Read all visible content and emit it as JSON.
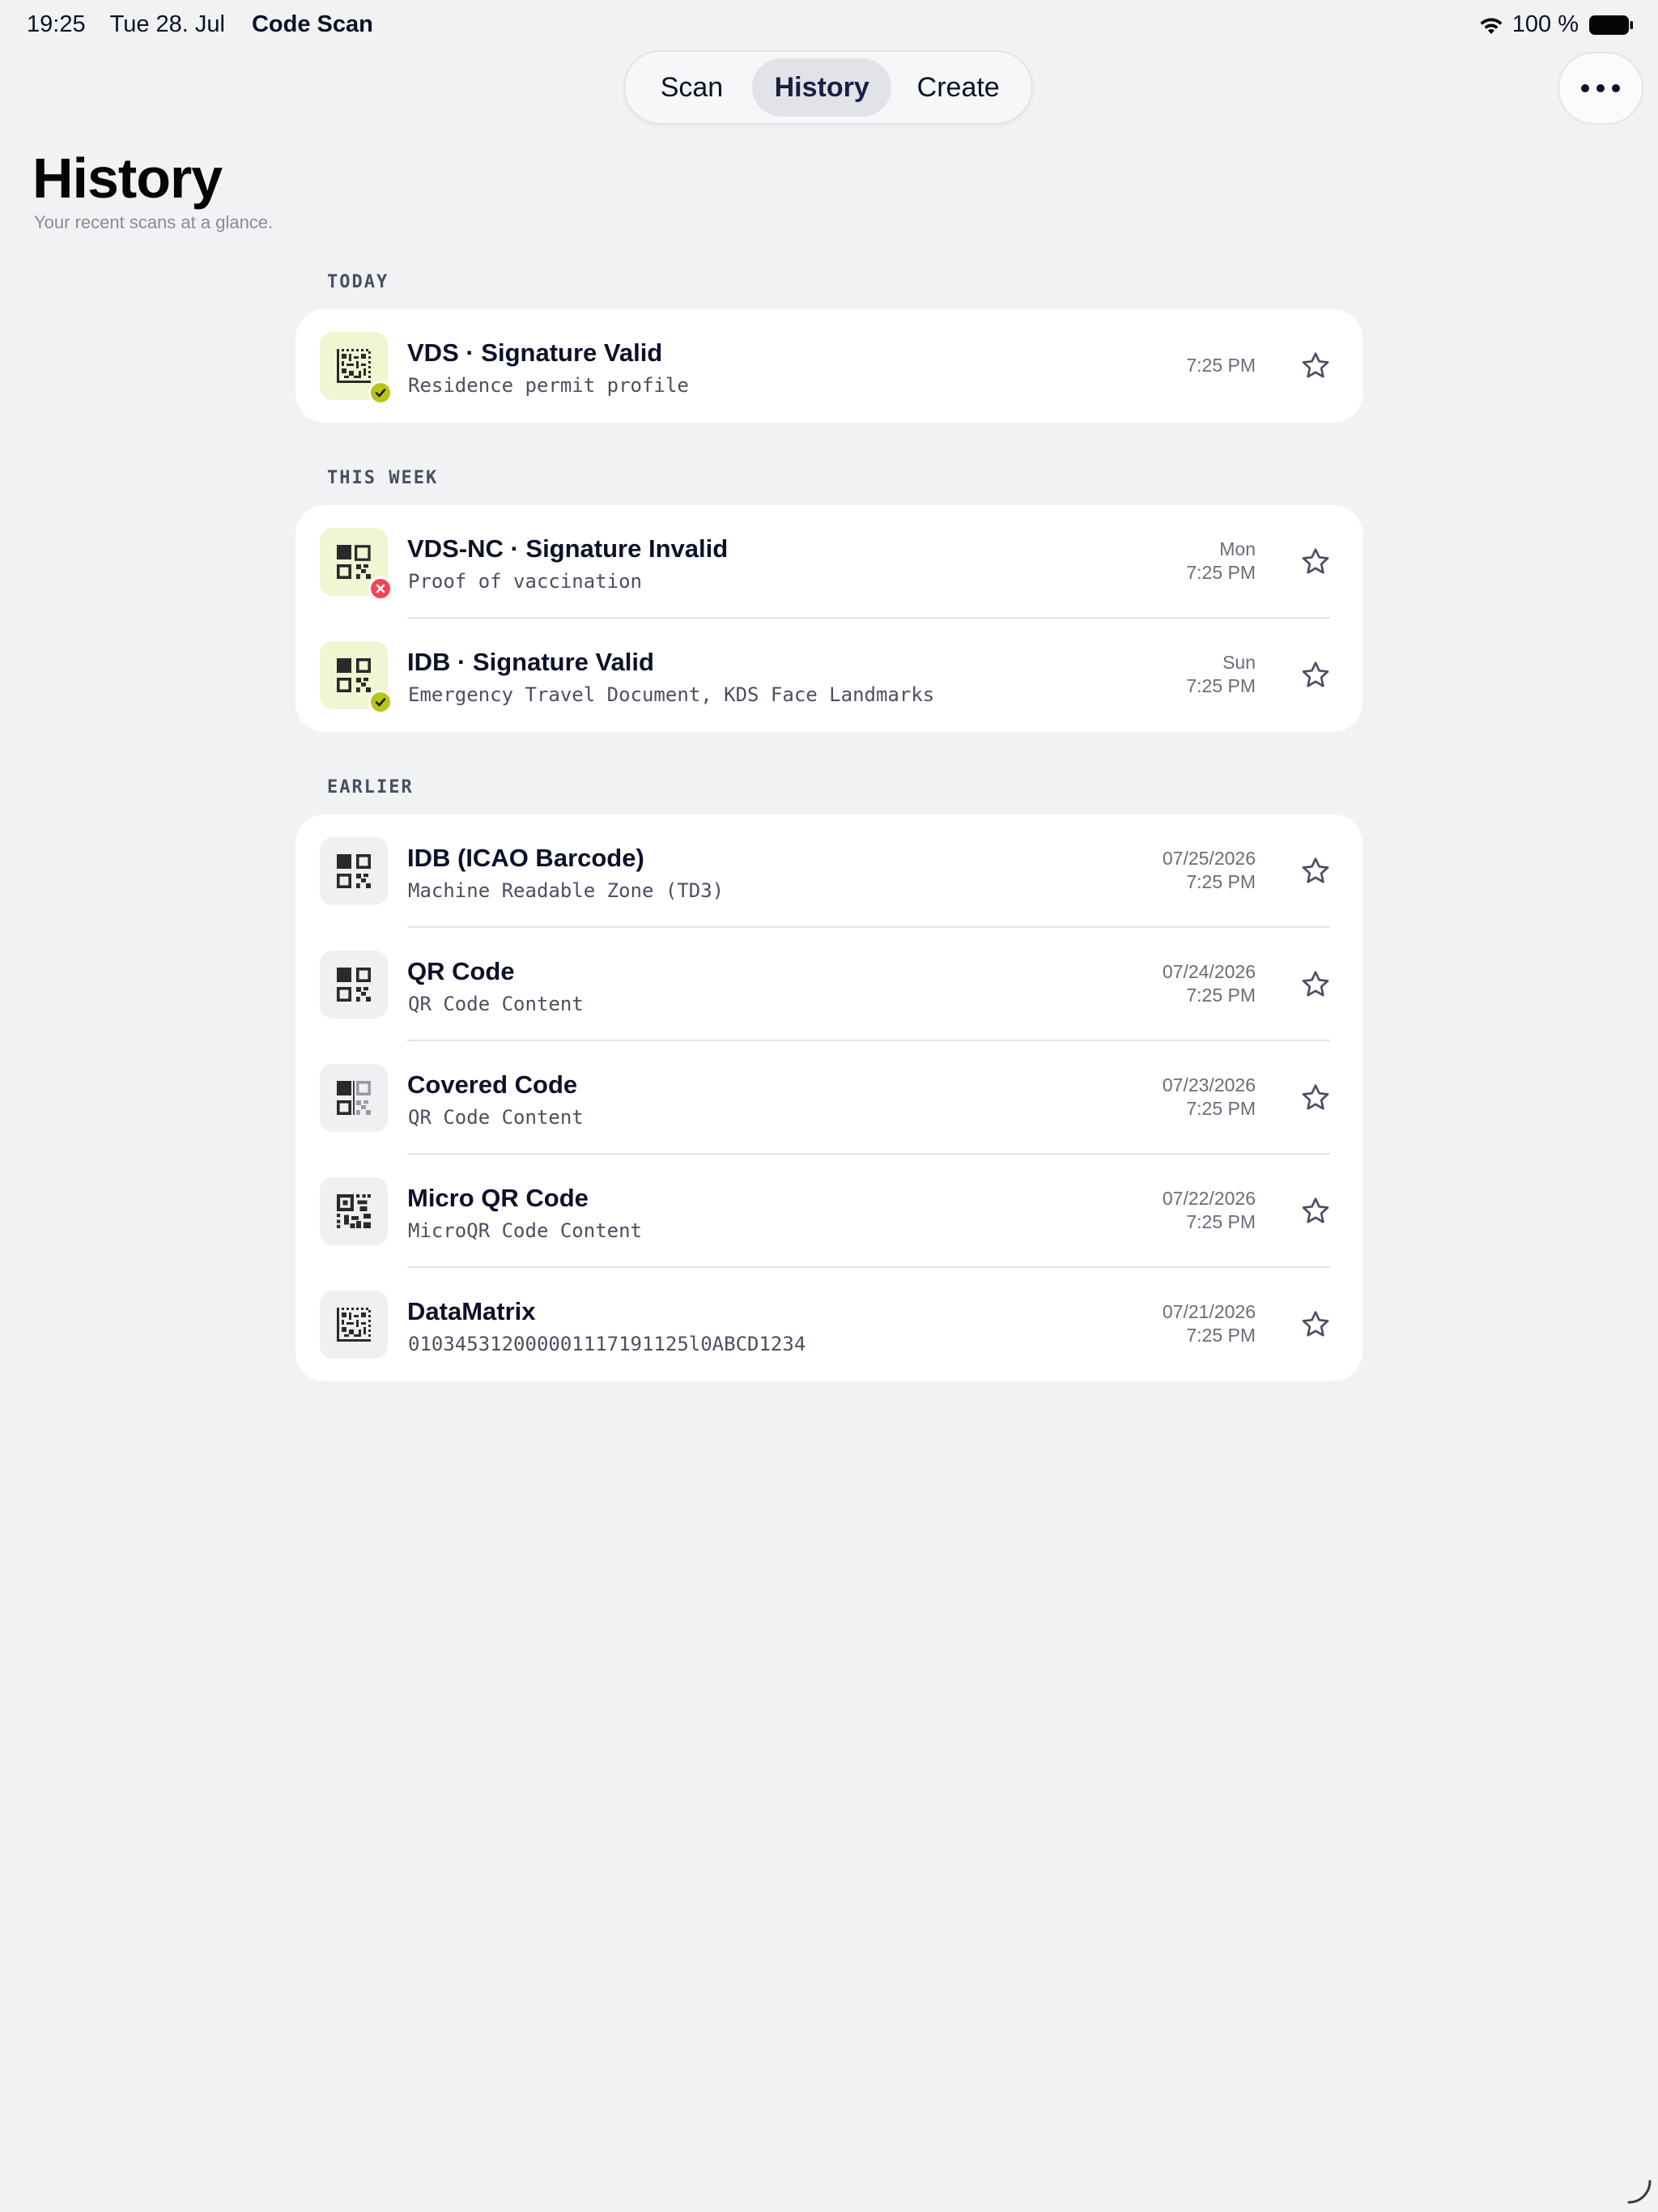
{
  "status_bar": {
    "time": "19:25",
    "date": "Tue 28. Jul",
    "app_name": "Code Scan",
    "battery_percent": "100 %"
  },
  "tabs": [
    {
      "label": "Scan",
      "selected": false
    },
    {
      "label": "History",
      "selected": true
    },
    {
      "label": "Create",
      "selected": false
    }
  ],
  "header": {
    "title": "History",
    "subtitle": "Your recent scans at a glance."
  },
  "sections": [
    {
      "label": "TODAY",
      "items": [
        {
          "title": "VDS · Signature Valid",
          "subtitle": "Residence permit profile",
          "day": "",
          "time": "7:25 PM",
          "icon": "datamatrix-icon",
          "status": "valid"
        }
      ]
    },
    {
      "label": "THIS WEEK",
      "items": [
        {
          "title": "VDS-NC · Signature Invalid",
          "subtitle": "Proof of vaccination",
          "day": "Mon",
          "time": "7:25 PM",
          "icon": "qr-code-icon",
          "status": "invalid"
        },
        {
          "title": "IDB · Signature Valid",
          "subtitle": "Emergency Travel Document, KDS Face Landmarks",
          "day": "Sun",
          "time": "7:25 PM",
          "icon": "qr-code-icon",
          "status": "valid"
        }
      ]
    },
    {
      "label": "EARLIER",
      "items": [
        {
          "title": "IDB (ICAO Barcode)",
          "subtitle": "Machine Readable Zone (TD3)",
          "day": "07/25/2026",
          "time": "7:25 PM",
          "icon": "qr-code-icon",
          "status": "none"
        },
        {
          "title": "QR Code",
          "subtitle": "QR Code Content",
          "day": "07/24/2026",
          "time": "7:25 PM",
          "icon": "qr-code-icon",
          "status": "none"
        },
        {
          "title": "Covered Code",
          "subtitle": "QR Code Content",
          "day": "07/23/2026",
          "time": "7:25 PM",
          "icon": "covered-code-icon",
          "status": "none"
        },
        {
          "title": "Micro QR Code",
          "subtitle": "MicroQR Code Content",
          "day": "07/22/2026",
          "time": "7:25 PM",
          "icon": "micro-qr-icon",
          "status": "none"
        },
        {
          "title": "DataMatrix",
          "subtitle": "010345312000001117191125l0ABCD1234",
          "day": "07/21/2026",
          "time": "7:25 PM",
          "icon": "datamatrix-icon",
          "status": "none"
        }
      ]
    }
  ],
  "colors": {
    "background": "#f1f2f4",
    "card": "#ffffff",
    "valid_badge": "#b8c514",
    "invalid_badge": "#f04658",
    "status_icon_bg": "#f2f5d2",
    "text_primary": "#0d1028"
  }
}
